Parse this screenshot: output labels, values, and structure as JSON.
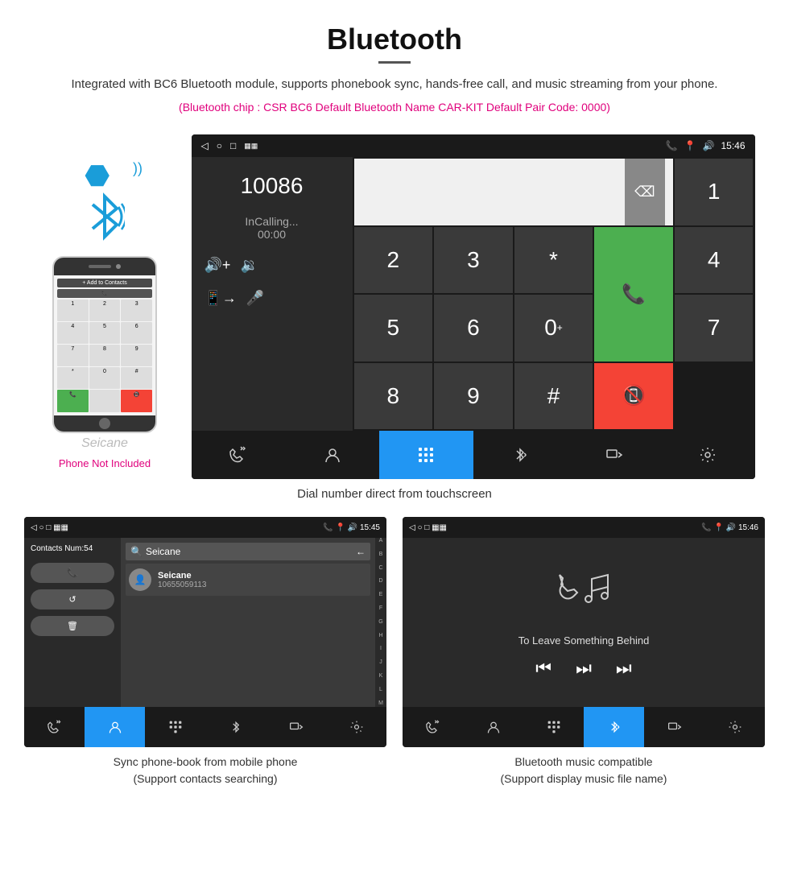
{
  "header": {
    "title": "Bluetooth",
    "description": "Integrated with BC6 Bluetooth module, supports phonebook sync, hands-free call, and music streaming from your phone.",
    "specs": "(Bluetooth chip : CSR BC6    Default Bluetooth Name CAR-KIT    Default Pair Code: 0000)"
  },
  "main_screen": {
    "status_bar": {
      "left": [
        "◁",
        "○",
        "□"
      ],
      "right": [
        "📞",
        "📍",
        "🔊",
        "15:46"
      ]
    },
    "number_display": "10086",
    "calling_text": "InCalling...",
    "calling_time": "00:00",
    "dialpad": {
      "keys": [
        "1",
        "2",
        "3",
        "*",
        "4",
        "5",
        "6",
        "0+",
        "7",
        "8",
        "9",
        "#"
      ]
    },
    "nav_items": [
      "📞⇄",
      "👤",
      "⊞",
      "✱",
      "□→",
      "⚙"
    ]
  },
  "caption_main": "Dial number direct from touchscreen",
  "phonebook_screen": {
    "status_bar": {
      "left": "◁  ○  □",
      "right": "📞 📍 🔊 15:45"
    },
    "contacts_num": "Contacts Num:54",
    "action_btns": [
      "📞",
      "↺",
      "🗑"
    ],
    "search_placeholder": "Seicane",
    "contact": {
      "name": "Seicane",
      "number": "10655059113"
    },
    "alphabet": [
      "A",
      "B",
      "C",
      "D",
      "E",
      "F",
      "G",
      "H",
      "I",
      "J",
      "K",
      "L",
      "M"
    ],
    "nav_items": [
      "📞⇄",
      "👤",
      "⊞",
      "✱",
      "□→",
      "⚙"
    ],
    "active_nav": 1
  },
  "music_screen": {
    "status_bar": {
      "left": "◁  ○  □",
      "right": "📞 📍 🔊 15:46"
    },
    "song_title": "To Leave Something Behind",
    "controls": [
      "⏮",
      "⏭",
      "⏭"
    ],
    "nav_items": [
      "📞⇄",
      "👤",
      "⊞",
      "✱",
      "□→",
      "⚙"
    ],
    "active_nav": 3
  },
  "caption_phonebook": "Sync phone-book from mobile phone\n(Support contacts searching)",
  "caption_music": "Bluetooth music compatible\n(Support display music file name)",
  "phone_not_included": "Phone Not Included",
  "seicane_watermark": "Seicane"
}
